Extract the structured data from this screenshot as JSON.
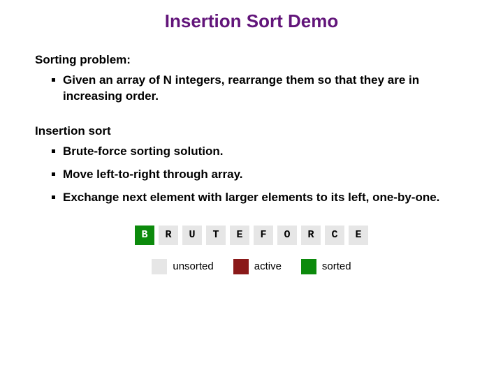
{
  "title": "Insertion Sort Demo",
  "section1": {
    "heading": "Sorting problem:",
    "items": [
      "Given an array of N integers, rearrange them so that they are in increasing order."
    ]
  },
  "section2": {
    "heading": "Insertion sort",
    "items": [
      "Brute-force sorting solution.",
      "Move left-to-right through array.",
      "Exchange next element with larger elements to its left, one-by-one."
    ]
  },
  "array": {
    "cells": [
      "B",
      "R",
      "U",
      "T",
      "E",
      "F",
      "O",
      "R",
      "C",
      "E"
    ],
    "states": [
      "sorted",
      "unsorted",
      "unsorted",
      "unsorted",
      "unsorted",
      "unsorted",
      "unsorted",
      "unsorted",
      "unsorted",
      "unsorted"
    ]
  },
  "legend": {
    "unsorted": "unsorted",
    "active": "active",
    "sorted": "sorted"
  }
}
